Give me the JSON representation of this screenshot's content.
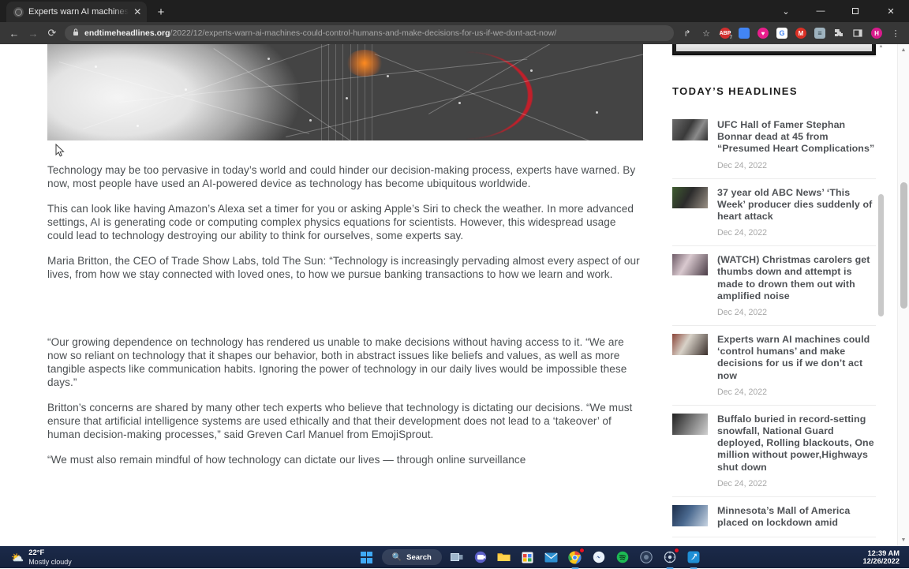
{
  "browser": {
    "tab": {
      "title": "Experts warn AI machines could",
      "favicon": "globe-icon",
      "close": "✕"
    },
    "newtab_label": "+",
    "window_controls": {
      "tab_search": "⌄",
      "minimize": "—",
      "maximize": "❐",
      "close": "✕"
    },
    "nav": {
      "back": "←",
      "forward": "→",
      "reload": "⟳"
    },
    "omnibox": {
      "lock_icon": "lock-icon",
      "domain": "endtimeheadlines.org",
      "path": "/2022/12/experts-warn-ai-machines-could-control-humans-and-make-decisions-for-us-if-we-dont-act-now/"
    },
    "toolbar_icons": [
      {
        "name": "share-icon",
        "glyph": "↱",
        "color": ""
      },
      {
        "name": "bookmark-star-icon",
        "glyph": "☆",
        "color": ""
      },
      {
        "name": "adblock-extension-icon",
        "glyph": "ABP",
        "color": "#d32f2f",
        "badge": "7"
      },
      {
        "name": "calendar-extension-icon",
        "glyph": "",
        "color": "#4285f4"
      },
      {
        "name": "heart-extension-icon",
        "glyph": "♥",
        "color": "#e91e8c"
      },
      {
        "name": "google-extension-icon",
        "glyph": "G",
        "color": "#ffffff"
      },
      {
        "name": "gmail-extension-icon",
        "glyph": "M",
        "color": "#d93025"
      },
      {
        "name": "list-extension-icon",
        "glyph": "≡",
        "color": "#607d8b"
      },
      {
        "name": "puzzle-extensions-icon",
        "glyph": "❖",
        "color": ""
      },
      {
        "name": "reading-list-icon",
        "glyph": "▣",
        "color": ""
      },
      {
        "name": "profile-avatar",
        "glyph": "H",
        "color": "#d81b8c"
      },
      {
        "name": "chrome-menu-icon",
        "glyph": "⋮",
        "color": ""
      }
    ]
  },
  "article": {
    "hero_image_alt": "robot-hand-technology-network-hero-image",
    "paragraphs": [
      "Technology may be too pervasive in today’s world and could hinder our decision-making process, experts have warned. By now, most people have used an AI-powered device as technology has become ubiquitous worldwide.",
      "This can look like having Amazon’s Alexa set a timer for you or asking Apple’s Siri to check the weather. In more advanced settings, AI is generating code or computing complex physics equations for scientists. However, this widespread usage could lead to technology destroying our ability to think for ourselves, some experts say.",
      "Maria Britton, the CEO of Trade Show Labs, told The Sun: “Technology is increasingly pervading almost every aspect of our lives, from how we stay connected with loved ones, to how we pursue banking transactions to how we learn and work.",
      "“Our growing dependence on technology has rendered us unable to make decisions without having access to it. “We are now so reliant on technology that it shapes our behavior, both in abstract issues like beliefs and values, as well as more tangible aspects like communication habits. Ignoring the power of technology in our daily lives would be impossible these days.”",
      "Britton’s concerns are shared by many other tech experts who believe that technology is dictating our decisions. “We must ensure that artificial intelligence systems are used ethically and that their development does not lead to a ‘takeover’ of human decision-making processes,” said Greven Carl Manuel from EmojiSprout.",
      "“We must also remain mindful of how technology can dictate our lives — through online surveillance"
    ]
  },
  "sidebar": {
    "title": "TODAY’S HEADLINES",
    "headlines": [
      {
        "title": "UFC Hall of Famer Stephan Bonnar dead at 45 from “Presumed Heart Complications”",
        "date": "Dec 24, 2022",
        "thumb": "ufc-bonnar-thumbnail"
      },
      {
        "title": "37 year old ABC News’ ‘This Week’ producer dies suddenly of heart attack",
        "date": "Dec 24, 2022",
        "thumb": "abc-producer-thumbnail"
      },
      {
        "title": "(WATCH) Christmas carolers get thumbs down and attempt is made to drown them out with amplified noise",
        "date": "Dec 24, 2022",
        "thumb": "christmas-carolers-thumbnail"
      },
      {
        "title": "Experts warn AI machines could ‘control humans’ and make decisions for us if we don’t act now",
        "date": "Dec 24, 2022",
        "thumb": "ai-machines-thumbnail"
      },
      {
        "title": "Buffalo buried in record-setting snowfall, National Guard deployed, Rolling blackouts, One million without power,Highways shut down",
        "date": "Dec 24, 2022",
        "thumb": "buffalo-snow-thumbnail"
      },
      {
        "title": "Minnesota’s Mall of America placed on lockdown amid",
        "date": "",
        "thumb": "mall-of-america-thumbnail"
      }
    ]
  },
  "taskbar": {
    "weather": {
      "temp": "22°F",
      "condition": "Mostly cloudy",
      "icon": "⛅"
    },
    "search_label": "Search",
    "apps": [
      {
        "name": "start-button",
        "glyph": ""
      },
      {
        "name": "search-button",
        "glyph": "⌕"
      },
      {
        "name": "task-view-button",
        "glyph": "▧"
      },
      {
        "name": "teams-chat-button",
        "glyph": "◓"
      },
      {
        "name": "file-explorer-button",
        "glyph": "Ὄ1"
      },
      {
        "name": "microsoft-store-button",
        "glyph": "▦"
      },
      {
        "name": "mail-button",
        "glyph": "✉"
      },
      {
        "name": "chrome-button",
        "glyph": "◉"
      },
      {
        "name": "messenger-button",
        "glyph": "●"
      },
      {
        "name": "spotify-button",
        "glyph": "♫"
      },
      {
        "name": "app-extra-button",
        "glyph": "◎"
      },
      {
        "name": "notification-app-button",
        "glyph": "⚙"
      },
      {
        "name": "blue-app-button",
        "glyph": "✈"
      }
    ],
    "clock": {
      "time": "12:39 AM",
      "date": "12/26/2022"
    }
  }
}
